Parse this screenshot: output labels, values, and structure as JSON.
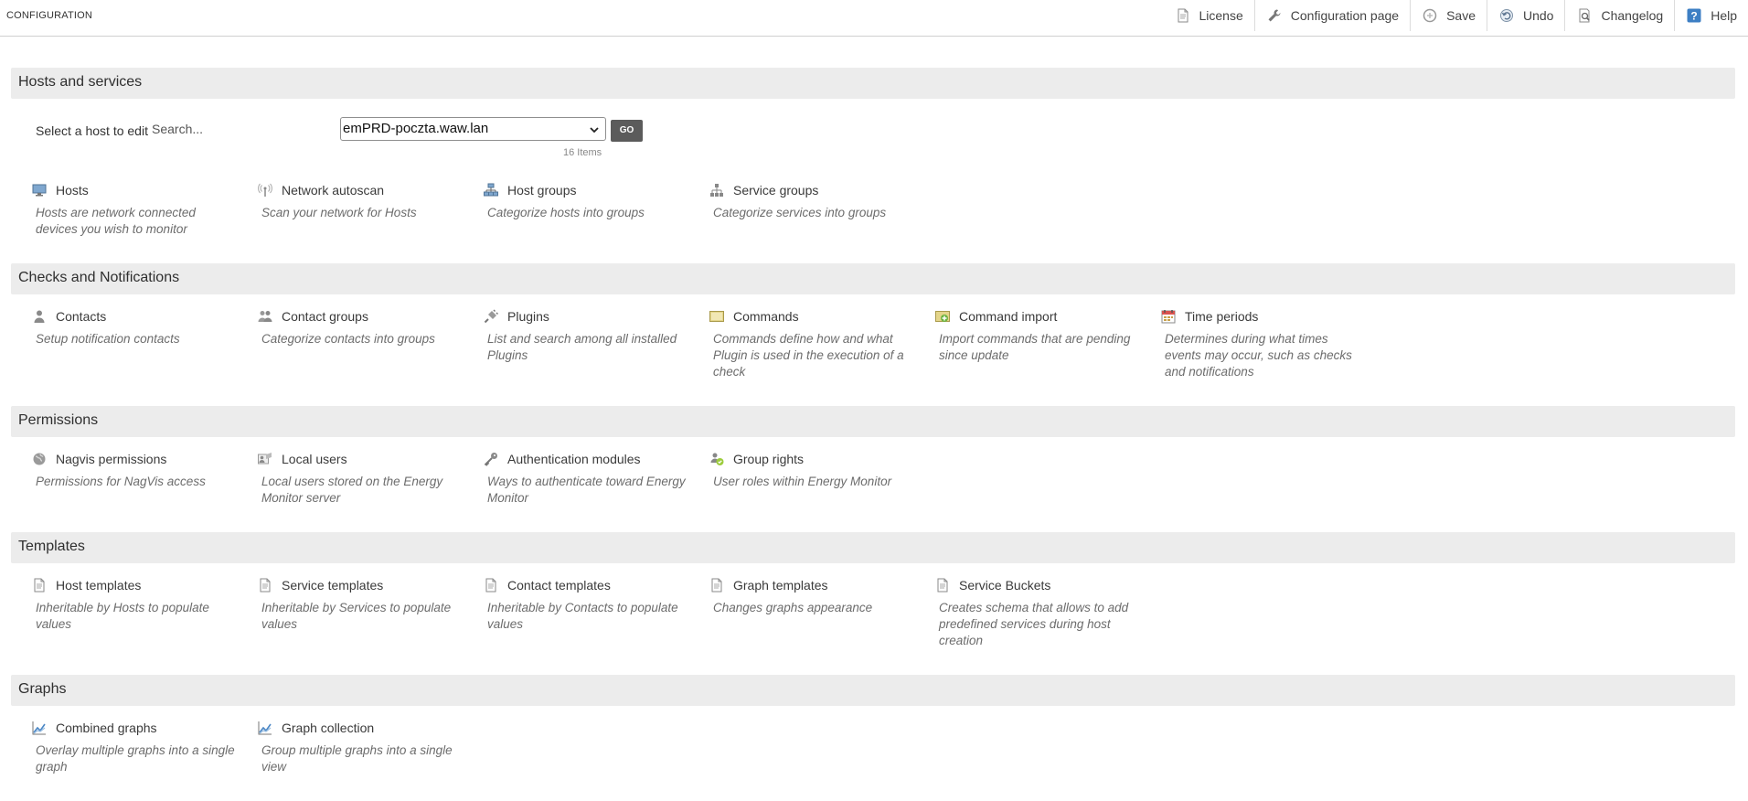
{
  "topbar": {
    "title": "CONFIGURATION",
    "actions": [
      {
        "label": "License",
        "icon": "document-icon"
      },
      {
        "label": "Configuration page",
        "icon": "wrench-icon"
      },
      {
        "label": "Save",
        "icon": "save-icon"
      },
      {
        "label": "Undo",
        "icon": "undo-icon"
      },
      {
        "label": "Changelog",
        "icon": "changelog-icon"
      },
      {
        "label": "Help",
        "icon": "help-icon"
      }
    ]
  },
  "host_select": {
    "label": "Select a host to edit",
    "search_placeholder": "Search...",
    "selected": "emPRD-poczta.waw.lan",
    "go_label": "GO",
    "count": "16 Items"
  },
  "sections": [
    {
      "title": "Hosts and services",
      "items": [
        {
          "label": "Hosts",
          "desc": "Hosts are network connected devices you wish to monitor",
          "icon": "monitor-icon"
        },
        {
          "label": "Network autoscan",
          "desc": "Scan your network for Hosts",
          "icon": "antenna-icon"
        },
        {
          "label": "Host groups",
          "desc": "Categorize hosts into groups",
          "icon": "network-tree-icon"
        },
        {
          "label": "Service groups",
          "desc": "Categorize services into groups",
          "icon": "hierarchy-icon"
        }
      ]
    },
    {
      "title": "Checks and Notifications",
      "items": [
        {
          "label": "Contacts",
          "desc": "Setup notification contacts",
          "icon": "person-icon"
        },
        {
          "label": "Contact groups",
          "desc": "Categorize contacts into groups",
          "icon": "people-icon"
        },
        {
          "label": "Plugins",
          "desc": "List and search among all installed Plugins",
          "icon": "plug-icon"
        },
        {
          "label": "Commands",
          "desc": "Commands define how and what Plugin is used in the execution of a check",
          "icon": "terminal-icon"
        },
        {
          "label": "Command import",
          "desc": "Import commands that are pending since update",
          "icon": "import-icon"
        },
        {
          "label": "Time periods",
          "desc": "Determines during what times events may occur, such as checks and notifications",
          "icon": "calendar-icon"
        }
      ]
    },
    {
      "title": "Permissions",
      "items": [
        {
          "label": "Nagvis permissions",
          "desc": "Permissions for NagVis access",
          "icon": "globe-icon"
        },
        {
          "label": "Local users",
          "desc": "Local users stored on the Energy Monitor server",
          "icon": "user-card-icon"
        },
        {
          "label": "Authentication modules",
          "desc": "Ways to authenticate toward Energy Monitor",
          "icon": "key-icon"
        },
        {
          "label": "Group rights",
          "desc": "User roles within Energy Monitor",
          "icon": "group-rights-icon"
        }
      ]
    },
    {
      "title": "Templates",
      "items": [
        {
          "label": "Host templates",
          "desc": "Inheritable by Hosts to populate values",
          "icon": "document-icon"
        },
        {
          "label": "Service templates",
          "desc": "Inheritable by Services to populate values",
          "icon": "document-icon"
        },
        {
          "label": "Contact templates",
          "desc": "Inheritable by Contacts to populate values",
          "icon": "document-icon"
        },
        {
          "label": "Graph templates",
          "desc": "Changes graphs appearance",
          "icon": "document-icon"
        },
        {
          "label": "Service Buckets",
          "desc": "Creates schema that allows to add predefined services during host creation",
          "icon": "document-icon"
        }
      ]
    },
    {
      "title": "Graphs",
      "items": [
        {
          "label": "Combined graphs",
          "desc": "Overlay multiple graphs into a single graph",
          "icon": "chart-icon"
        },
        {
          "label": "Graph collection",
          "desc": "Group multiple graphs into a single view",
          "icon": "chart-icon"
        }
      ]
    }
  ]
}
